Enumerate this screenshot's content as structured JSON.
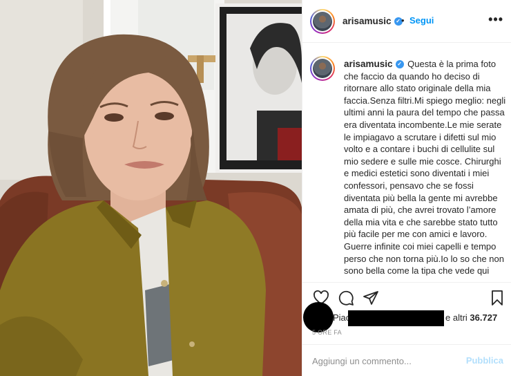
{
  "post": {
    "username": "arisamusic",
    "verified_mark": "✓",
    "separator": "•",
    "follow_label": "Segui",
    "more_label": "•••",
    "caption": "Questa è la prima foto che faccio da quando ho deciso di ritornare allo stato originale della mia faccia.Senza filtri.Mi spiego meglio: negli ultimi anni la paura del tempo che passa era diventata incombente.Le mie serate le impiagavo a scrutare i difetti sul mio volto e a contare i buchi di cellulite sul mio sedere e sulle mie cosce. Chirurghi e medici estetici sono diventati i miei confessori, pensavo che se fossi diventata più bella la gente mi avrebbe amata di più, che avrei trovato l’amore della mia vita e che sarebbe stato tutto più facile per me con amici e lavoro. Guerre infinite coi miei capelli e tempo perso che non torna più.Io lo so che non sono bella come la tipa che vede qui"
  },
  "actions": {
    "like_icon": "heart-icon",
    "comment_icon": "comment-icon",
    "share_icon": "paper-plane-icon",
    "save_icon": "bookmark-icon"
  },
  "likes": {
    "prefix": "Piace",
    "suffix": "e altri",
    "count": "36.727"
  },
  "timestamp": "5 ORE FA",
  "comment": {
    "placeholder": "Aggiungi un commento...",
    "publish_label": "Pubblica"
  },
  "colors": {
    "accent": "#0095f6",
    "publish_disabled": "#b2dffc",
    "verified": "#3897f0",
    "muted": "#8e8e8e"
  }
}
